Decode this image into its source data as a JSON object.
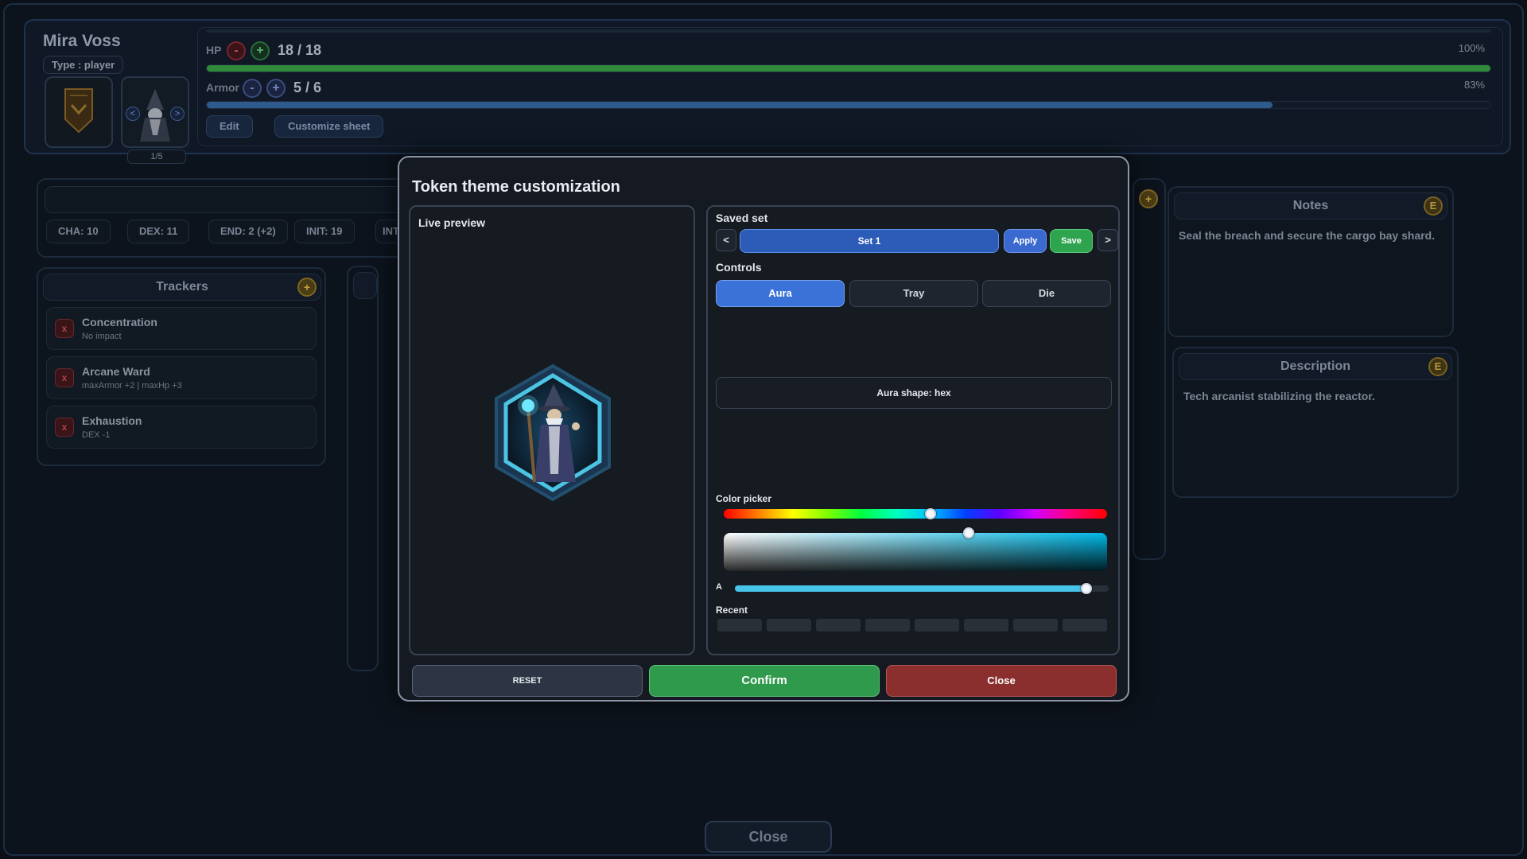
{
  "character": {
    "name": "Mira Voss",
    "type_label": "Type : player",
    "portrait_counter": "1/5",
    "portrait_prev": "<",
    "portrait_next": ">"
  },
  "hp": {
    "label": "HP",
    "minus": "-",
    "plus": "+",
    "value": "18 / 18",
    "percent_label": "100%",
    "fill_fraction": 1.0
  },
  "armor": {
    "label": "Armor",
    "minus": "-",
    "plus": "+",
    "value": "5 / 6",
    "percent_label": "83%",
    "fill_fraction": 0.83
  },
  "header_buttons": {
    "edit": "Edit",
    "customize": "Customize sheet"
  },
  "stats": [
    "CHA: 10",
    "DEX: 11",
    "END: 2 (+2)",
    "INIT: 19",
    "INT"
  ],
  "trackers": {
    "title": "Trackers",
    "add": "+",
    "items": [
      {
        "name": "Concentration",
        "sub": "No impact",
        "remove": "x"
      },
      {
        "name": "Arcane Ward",
        "sub": "maxArmor +2 | maxHp +3",
        "remove": "x"
      },
      {
        "name": "Exhaustion",
        "sub": "DEX -1",
        "remove": "x"
      }
    ]
  },
  "notes": {
    "title": "Notes",
    "edit": "E",
    "text": "Seal the breach and secure the cargo bay shard."
  },
  "description": {
    "title": "Description",
    "edit": "E",
    "text": "Tech arcanist stabilizing the reactor."
  },
  "middle_add": "+",
  "bottom_close": "Close",
  "modal": {
    "title": "Token theme customization",
    "live_preview_label": "Live preview",
    "saved_set_label": "Saved set",
    "prev": "<",
    "next": ">",
    "set_name": "Set 1",
    "apply": "Apply",
    "save": "Save",
    "controls_label": "Controls",
    "tabs": [
      "Aura",
      "Tray",
      "Die"
    ],
    "active_tab": "Aura",
    "aura_shape": "Aura shape: hex",
    "color_picker_label": "Color picker",
    "hue_position": 0.54,
    "sv_saturation": 0.64,
    "alpha_label": "A",
    "alpha": 0.94,
    "recent_label": "Recent",
    "recent_count": 8,
    "buttons": {
      "reset": "RESET",
      "confirm": "Confirm",
      "close": "Close"
    }
  },
  "colors": {
    "aura": "#4cc4e4",
    "hp_bar": "#2f8a3c",
    "armor_bar": "#2e5a8e",
    "confirm": "#2f9a4c",
    "close": "#8a2e2e",
    "accent": "#3a72d8"
  }
}
